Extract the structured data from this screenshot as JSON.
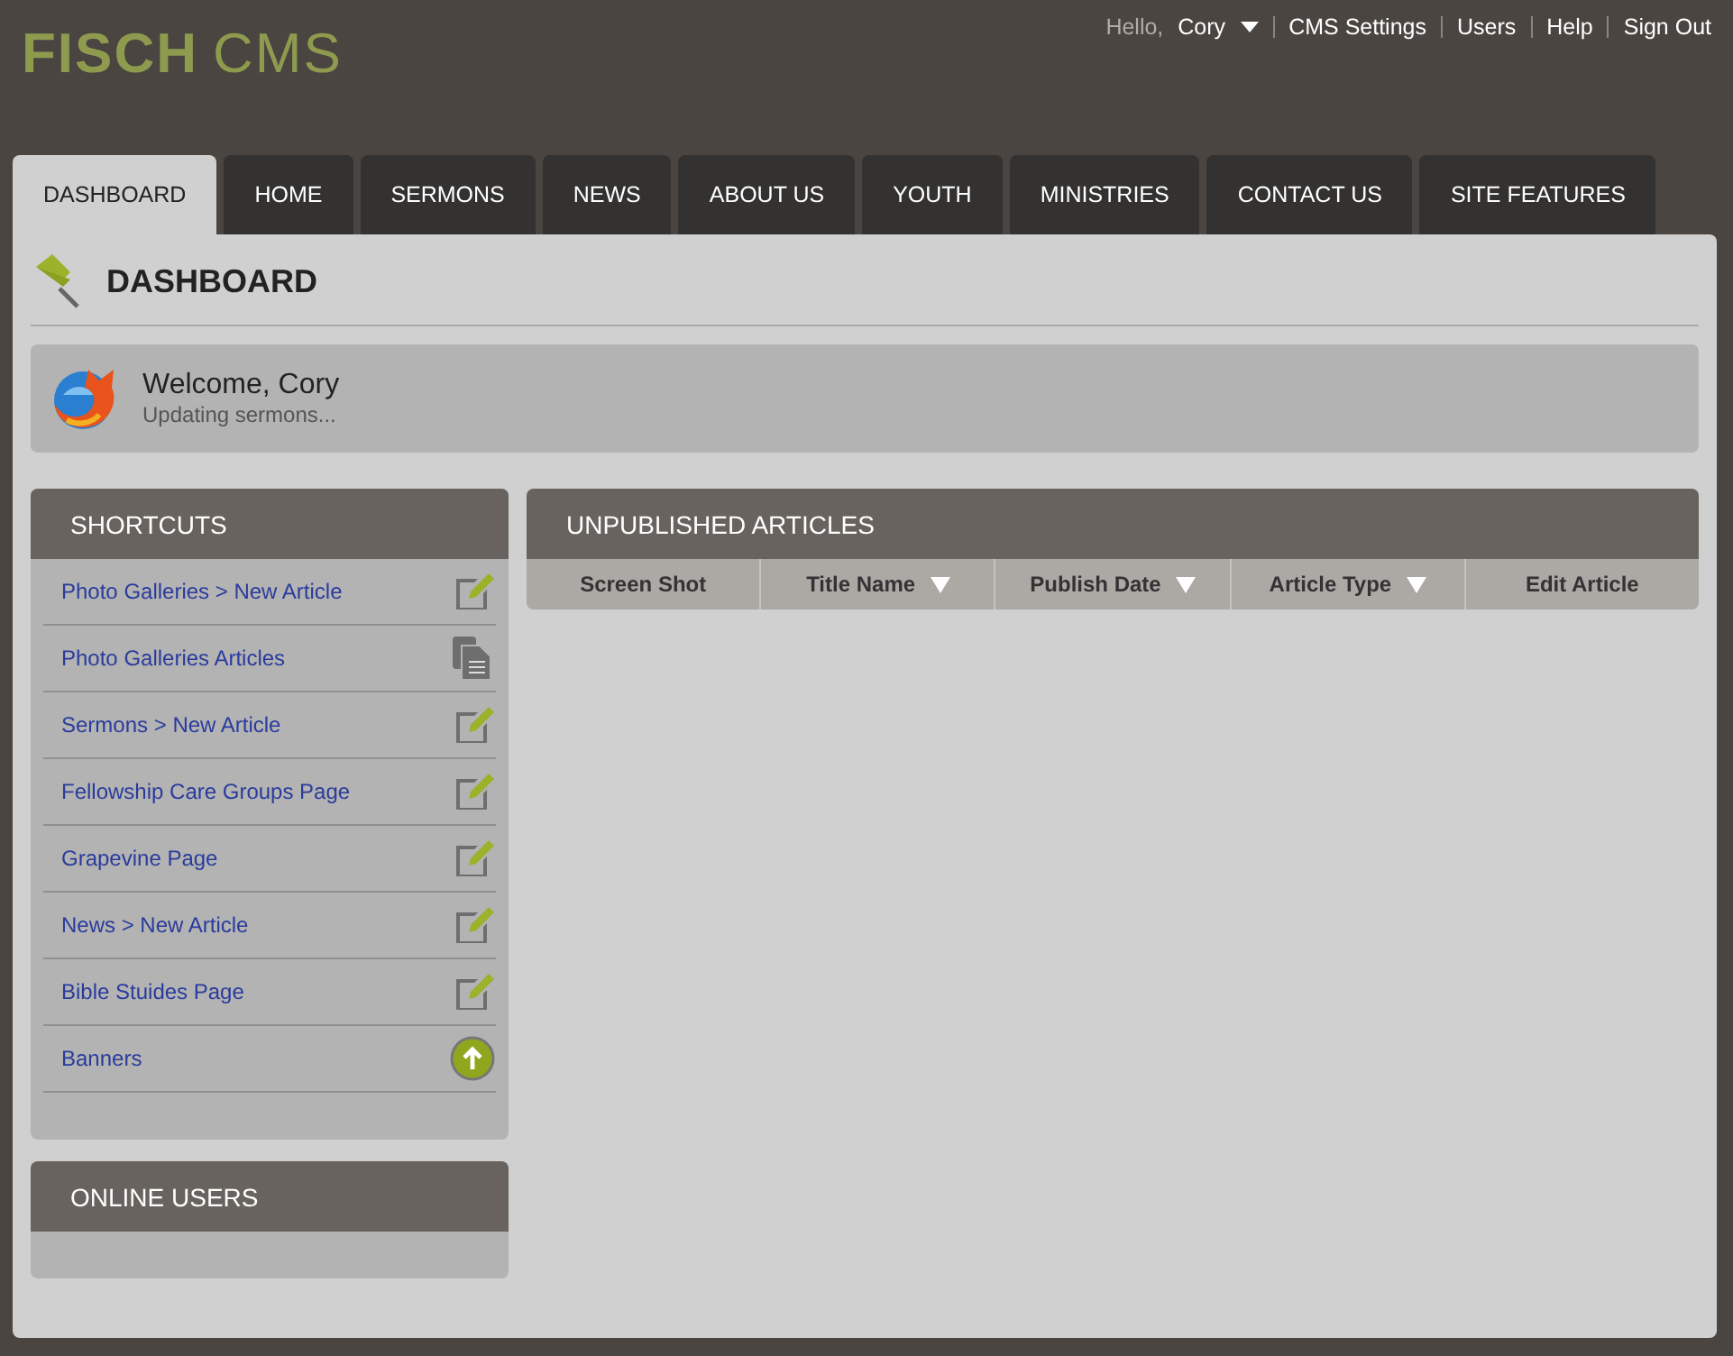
{
  "logo": {
    "bold": "FISCH",
    "light": "CMS"
  },
  "user_menu": {
    "greeting": "Hello,",
    "name": "Cory",
    "links": [
      "CMS Settings",
      "Users",
      "Help",
      "Sign Out"
    ]
  },
  "tabs": [
    {
      "label": "DASHBOARD",
      "selected": true
    },
    {
      "label": "HOME",
      "selected": false
    },
    {
      "label": "SERMONS",
      "selected": false
    },
    {
      "label": "NEWS",
      "selected": false
    },
    {
      "label": "ABOUT US",
      "selected": false
    },
    {
      "label": "YOUTH",
      "selected": false
    },
    {
      "label": "MINISTRIES",
      "selected": false
    },
    {
      "label": "CONTACT US",
      "selected": false
    },
    {
      "label": "SITE FEATURES",
      "selected": false
    }
  ],
  "page_title": "DASHBOARD",
  "welcome": {
    "title": "Welcome, Cory",
    "status": "Updating sermons..."
  },
  "shortcuts": {
    "title": "SHORTCUTS",
    "items": [
      {
        "label": "Photo Galleries > New Article",
        "kind": "edit"
      },
      {
        "label": "Photo Galleries Articles",
        "kind": "pages"
      },
      {
        "label": "Sermons > New Article",
        "kind": "edit"
      },
      {
        "label": "Fellowship Care Groups Page",
        "kind": "edit"
      },
      {
        "label": "Grapevine Page",
        "kind": "edit"
      },
      {
        "label": "News > New Article",
        "kind": "edit"
      },
      {
        "label": "Bible Stuides Page",
        "kind": "edit"
      },
      {
        "label": "Banners",
        "kind": "upload"
      }
    ]
  },
  "online_users": {
    "title": "ONLINE USERS"
  },
  "unpublished": {
    "title": "UNPUBLISHED ARTICLES",
    "columns": [
      {
        "label": "Screen Shot",
        "sortable": false
      },
      {
        "label": "Title Name",
        "sortable": true
      },
      {
        "label": "Publish Date",
        "sortable": true
      },
      {
        "label": "Article Type",
        "sortable": true
      },
      {
        "label": "Edit Article",
        "sortable": false
      }
    ]
  }
}
